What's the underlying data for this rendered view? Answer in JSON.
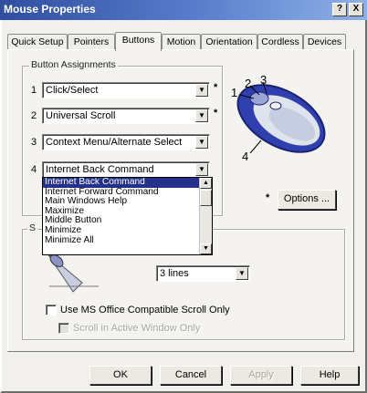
{
  "window": {
    "title": "Mouse Properties",
    "help_btn": "?",
    "close_btn": "X"
  },
  "tabs": [
    "Quick Setup",
    "Pointers",
    "Buttons",
    "Motion",
    "Orientation",
    "Cordless",
    "Devices"
  ],
  "active_tab": "Buttons",
  "button_assignments": {
    "group_label": "Button Assignments",
    "rows": [
      {
        "num": "1",
        "value": "Click/Select",
        "starred": true,
        "star": "*"
      },
      {
        "num": "2",
        "value": "Universal Scroll",
        "starred": true,
        "star": "*"
      },
      {
        "num": "3",
        "value": "Context Menu/Alternate Select",
        "starred": false
      },
      {
        "num": "4",
        "value": "Internet Back Command",
        "starred": false
      }
    ],
    "dropdown_options": [
      "Internet Back Command",
      "Internet Forward Command",
      "Main Windows Help",
      "Maximize",
      "Middle Button",
      "Minimize",
      "Minimize All"
    ],
    "selected_option": "Internet Back Command"
  },
  "mouse_callouts": [
    "1",
    "2",
    "3",
    "4"
  ],
  "options_button": {
    "star": "*",
    "label": "Options ..."
  },
  "scroll_group": {
    "label_visible": "S",
    "lines_value": "3 lines",
    "ms_office_checkbox": "Use MS Office Compatible Scroll Only",
    "disabled_checkbox": "Scroll in Active Window Only"
  },
  "footer": {
    "ok": "OK",
    "cancel": "Cancel",
    "apply": "Apply",
    "help": "Help"
  },
  "colors": {
    "title_start": "#2f4e9e",
    "title_end": "#8fb1e8",
    "selection": "#24318a",
    "mouse_blue": "#2f3fae"
  }
}
